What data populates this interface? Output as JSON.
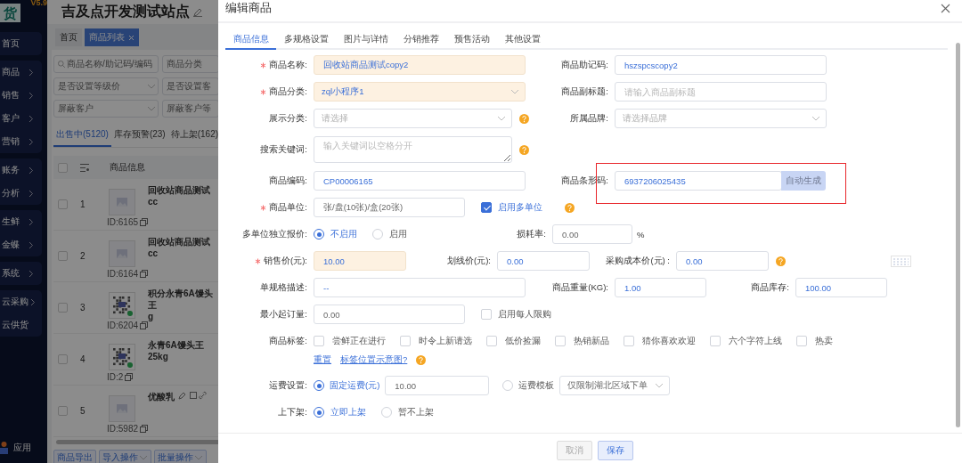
{
  "sidebar": {
    "version": "V5.9",
    "logo": "货",
    "groups": [
      {
        "items": [
          {
            "label": "首页",
            "arrow": false
          }
        ]
      },
      {
        "items": [
          {
            "label": "商品",
            "arrow": true
          },
          {
            "label": "销售",
            "arrow": true
          },
          {
            "label": "客户",
            "arrow": true
          },
          {
            "label": "营销",
            "arrow": true
          }
        ]
      },
      {
        "items": [
          {
            "label": "账务",
            "arrow": true
          },
          {
            "label": "分析",
            "arrow": true
          }
        ]
      },
      {
        "items": [
          {
            "label": "生鲜",
            "arrow": true
          },
          {
            "label": "金蝶",
            "arrow": true
          }
        ]
      },
      {
        "items": [
          {
            "label": "系统",
            "arrow": true
          }
        ]
      },
      {
        "items": [
          {
            "label": "云采购",
            "arrow": true
          },
          {
            "label": "云供货",
            "arrow": false
          }
        ]
      }
    ],
    "footer": "应用"
  },
  "workspace": {
    "title": "吉及点开发测试站点",
    "tabs": [
      {
        "label": "首页",
        "selected": false,
        "closable": false
      },
      {
        "label": "商品列表",
        "selected": true,
        "closable": true
      }
    ],
    "filters": [
      {
        "kind": "search",
        "placeholder": "商品名称/助记码/编码"
      },
      {
        "kind": "input",
        "placeholder": "商品分类"
      },
      {
        "kind": "select",
        "placeholder": "是否设置等级价"
      },
      {
        "kind": "input",
        "placeholder": "是否设置客"
      },
      {
        "kind": "select",
        "placeholder": "屏蔽客户"
      },
      {
        "kind": "input",
        "placeholder": "屏蔽客户等"
      }
    ],
    "status_tabs": [
      {
        "label": "出售中(5120)",
        "selected": true
      },
      {
        "label": "库存预警(23)",
        "selected": false
      },
      {
        "label": "待上架(162)",
        "selected": false
      }
    ],
    "table": {
      "all_checked": false,
      "columns": [
        "商品信息"
      ],
      "rows": [
        {
          "checked": false,
          "index": "1",
          "kind": "placeholder",
          "id": "ID:6165",
          "name": [
            "回收站商品测试cc"
          ],
          "tools": false
        },
        {
          "checked": false,
          "index": "2",
          "kind": "placeholder",
          "id": "ID:6164",
          "name": [
            "回收站商品测试cc"
          ],
          "tools": false
        },
        {
          "checked": false,
          "index": "3",
          "kind": "qr",
          "id": "ID:6204",
          "name": [
            "积分永青6A馒头王",
            "g"
          ],
          "tools": false
        },
        {
          "checked": false,
          "index": "4",
          "kind": "qr",
          "id": "ID:2",
          "name": [
            "永青6A馒头王25kg"
          ],
          "tools": false
        },
        {
          "checked": false,
          "index": "5",
          "kind": "placeholder",
          "id": "ID:5982",
          "name": [
            "优酸乳"
          ],
          "tools": true
        }
      ]
    },
    "actions": [
      {
        "label": "商品导出",
        "dropdown": false
      },
      {
        "label": "导入操作",
        "dropdown": true
      },
      {
        "label": "批量操作",
        "dropdown": true
      }
    ]
  },
  "dialog": {
    "title": "编辑商品",
    "tabs": [
      {
        "label": "商品信息",
        "selected": true
      },
      {
        "label": "多规格设置",
        "selected": false
      },
      {
        "label": "图片与详情",
        "selected": false
      },
      {
        "label": "分销推荐",
        "selected": false
      },
      {
        "label": "预售活动",
        "selected": false
      },
      {
        "label": "其他设置",
        "selected": false
      }
    ],
    "rows": [
      {
        "groups": [
          {
            "label": "商品名称:",
            "required": true,
            "controls": [
              {
                "kind": "input",
                "value": "回收站商品测试copy2",
                "highlighted": true
              }
            ]
          },
          {
            "label": "商品助记码:",
            "controls": [
              {
                "kind": "input",
                "value": "hszspcscopy2"
              }
            ]
          }
        ]
      },
      {
        "groups": [
          {
            "label": "商品分类:",
            "required": true,
            "controls": [
              {
                "kind": "select",
                "value": "zql小程序1",
                "highlighted": true
              }
            ]
          },
          {
            "label": "商品副标题:",
            "controls": [
              {
                "kind": "input",
                "placeholder": "请输入商品副标题"
              }
            ]
          }
        ]
      },
      {
        "groups": [
          {
            "label": "展示分类:",
            "controls": [
              {
                "kind": "select",
                "placeholder": "请选择"
              },
              {
                "kind": "help"
              }
            ]
          },
          {
            "label": "所属品牌:",
            "controls": [
              {
                "kind": "select",
                "placeholder": "请选择品牌"
              }
            ]
          }
        ]
      },
      {
        "groups": [
          {
            "label": "搜索关键词:",
            "controls": [
              {
                "kind": "textarea",
                "placeholder": "输入关键词以空格分开"
              },
              {
                "kind": "help"
              }
            ]
          }
        ]
      },
      {
        "groups": [
          {
            "label": "商品编码:",
            "controls": [
              {
                "kind": "input",
                "value": "CP00006165"
              }
            ]
          },
          {
            "label": "商品条形码:",
            "annotated": true,
            "controls": [
              {
                "kind": "input",
                "value": "6937206025435"
              },
              {
                "kind": "button",
                "label": "自动生成",
                "disabled": true
              }
            ]
          }
        ]
      },
      {
        "groups": [
          {
            "label": "商品单位:",
            "required": true,
            "controls": [
              {
                "kind": "input",
                "value": "张/盘(10张)/盒(20张)",
                "muted": true
              },
              {
                "kind": "checkbox",
                "label": "启用多单位",
                "checked": true
              },
              {
                "kind": "help"
              }
            ]
          }
        ]
      },
      {
        "groups": [
          {
            "label": "多单位独立报价:",
            "controls": [
              {
                "kind": "radio",
                "label": "不启用",
                "selected": true
              },
              {
                "kind": "radio",
                "label": "启用",
                "selected": false
              }
            ]
          },
          {
            "label": "损耗率:",
            "controls": [
              {
                "kind": "input",
                "value": "0.00",
                "muted": true
              },
              {
                "kind": "text",
                "text": "%"
              }
            ]
          }
        ]
      },
      {
        "groups": [
          {
            "label": "销售价(元):",
            "required": true,
            "controls": [
              {
                "kind": "input",
                "value": "10.00",
                "highlighted": true
              }
            ]
          },
          {
            "label": "划线价(元):",
            "controls": [
              {
                "kind": "input",
                "value": "0.00"
              }
            ]
          },
          {
            "label": "采购成本价(元) :",
            "controls": [
              {
                "kind": "input",
                "value": "0.00"
              },
              {
                "kind": "help"
              }
            ]
          },
          {
            "controls": [
              {
                "kind": "image"
              }
            ]
          }
        ]
      },
      {
        "groups": [
          {
            "label": "单规格描述:",
            "controls": [
              {
                "kind": "input",
                "value": "--"
              }
            ]
          },
          {
            "label": "商品重量(KG):",
            "controls": [
              {
                "kind": "input",
                "value": "1.00"
              }
            ]
          },
          {
            "label": "商品库存:",
            "controls": [
              {
                "kind": "input",
                "value": "100.00"
              }
            ]
          }
        ]
      },
      {
        "groups": [
          {
            "label": "最小起订量:",
            "controls": [
              {
                "kind": "input",
                "value": "0.00",
                "muted": true
              },
              {
                "kind": "checkbox",
                "label": "启用每人限购",
                "checked": false
              }
            ]
          }
        ]
      },
      {
        "groups": [
          {
            "label": "商品标签:",
            "controls": [
              {
                "kind": "checkbox",
                "label": "尝鲜正在进行",
                "checked": false
              },
              {
                "kind": "checkbox",
                "label": "时令上新请选",
                "checked": false
              },
              {
                "kind": "checkbox",
                "label": "低价捡漏",
                "checked": false
              },
              {
                "kind": "checkbox",
                "label": "热销新品",
                "checked": false
              },
              {
                "kind": "checkbox",
                "label": "猜你喜欢欢迎",
                "checked": false
              },
              {
                "kind": "checkbox",
                "label": "六个字符上线",
                "checked": false
              },
              {
                "kind": "checkbox",
                "label": "热卖",
                "checked": false
              }
            ]
          }
        ]
      },
      {
        "groups": [
          {
            "controls": [
              {
                "kind": "link",
                "label": "重置"
              },
              {
                "kind": "link",
                "label": "标签位置示意图?"
              },
              {
                "kind": "help"
              }
            ]
          }
        ]
      },
      {
        "groups": [
          {
            "label": "运费设置:",
            "controls": [
              {
                "kind": "radio",
                "label": "固定运费(元)",
                "selected": true
              },
              {
                "kind": "input",
                "value": "10.00",
                "muted": true
              },
              {
                "kind": "radio",
                "label": "运费模板",
                "selected": false
              },
              {
                "kind": "select",
                "value": "仅限制湖北区域下单",
                "muted": true
              }
            ]
          }
        ]
      },
      {
        "groups": [
          {
            "label": "上下架:",
            "controls": [
              {
                "kind": "radio",
                "label": "立即上架",
                "selected": true
              },
              {
                "kind": "radio",
                "label": "暂不上架",
                "selected": false
              }
            ]
          }
        ]
      }
    ],
    "footer": [
      {
        "label": "取消",
        "kind": "cancel"
      },
      {
        "label": "保存",
        "kind": "primary"
      }
    ]
  }
}
